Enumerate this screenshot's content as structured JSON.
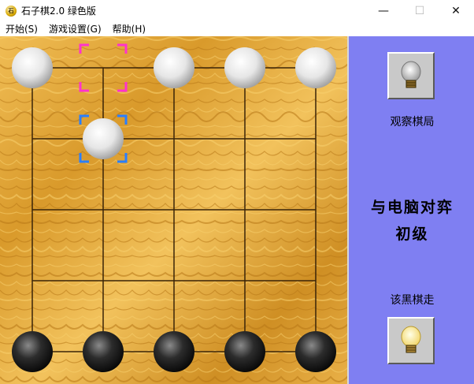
{
  "window": {
    "title": "石子棋2.0 绿色版",
    "app_icon_glyph": "石",
    "minimize_glyph": "—",
    "maximize_glyph": "☐",
    "close_glyph": "✕"
  },
  "menu": {
    "items": [
      {
        "label": "开始(S)"
      },
      {
        "label": "游戏设置(G)"
      },
      {
        "label": "帮助(H)"
      }
    ]
  },
  "board": {
    "rows": 5,
    "cols": 5,
    "white_pieces": [
      [
        0,
        0
      ],
      [
        0,
        2
      ],
      [
        0,
        3
      ],
      [
        0,
        4
      ],
      [
        1,
        1
      ]
    ],
    "black_pieces": [
      [
        4,
        0
      ],
      [
        4,
        1
      ],
      [
        4,
        2
      ],
      [
        4,
        3
      ],
      [
        4,
        4
      ]
    ],
    "selection_from": [
      0,
      1
    ],
    "selection_to": [
      1,
      1
    ],
    "colors": {
      "wood": "#e4a83a",
      "from_marker": "#ff33cc",
      "to_marker": "#2a7fff",
      "white_piece": "#e8e8e8",
      "black_piece": "#222222"
    }
  },
  "panel": {
    "observe_label": "观察棋局",
    "mode_line1": "与电脑对弈",
    "mode_line2": "初级",
    "turn_label": "该黑棋走",
    "bulb_top_icon": "lightbulb-off-icon",
    "bulb_bottom_icon": "lightbulb-on-icon",
    "background": "#7f7ff2"
  }
}
